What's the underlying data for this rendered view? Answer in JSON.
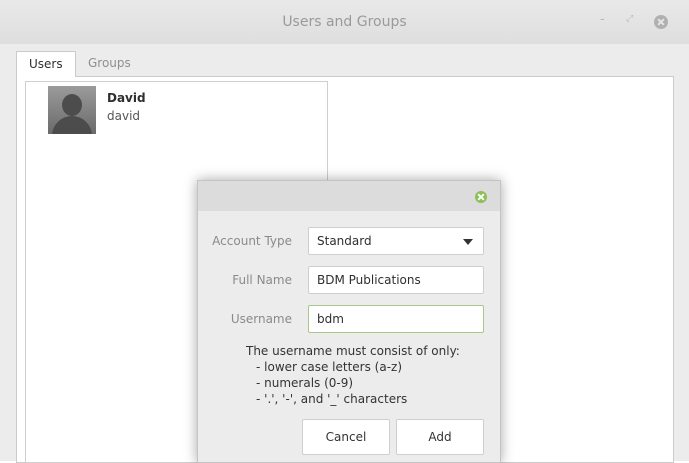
{
  "window": {
    "title": "Users and Groups",
    "controls": {
      "minimize": "-",
      "maximize": "⤢",
      "close_icon": "close-icon"
    }
  },
  "tabs": [
    {
      "label": "Users",
      "active": true
    },
    {
      "label": "Groups",
      "active": false
    }
  ],
  "users": [
    {
      "display_name": "David",
      "username": "david",
      "avatar_icon": "user-avatar"
    }
  ],
  "dialog": {
    "fields": {
      "account_type": {
        "label": "Account Type",
        "value": "Standard"
      },
      "full_name": {
        "label": "Full Name",
        "value": "BDM Publications"
      },
      "username": {
        "label": "Username",
        "value": "bdm"
      }
    },
    "rules": {
      "heading": "The username must consist of only:",
      "items": [
        "- lower case letters (a-z)",
        "- numerals (0-9)",
        "- '.', '-', and '_' characters"
      ]
    },
    "buttons": {
      "cancel": "Cancel",
      "add": "Add"
    },
    "colors": {
      "close_accent": "#8bbf57",
      "focus_border": "#a9c98a"
    }
  }
}
